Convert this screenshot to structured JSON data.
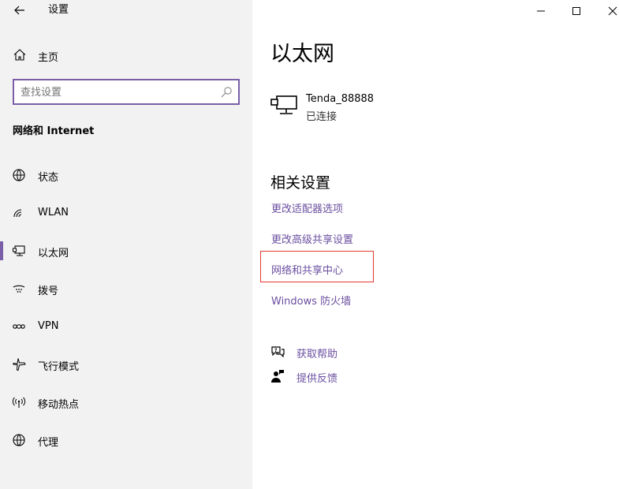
{
  "app": {
    "title": "设置"
  },
  "sidebar": {
    "home_label": "主页",
    "search_placeholder": "查找设置",
    "section_title": "网络和 Internet",
    "items": [
      {
        "label": "状态",
        "icon": "globe-status-icon"
      },
      {
        "label": "WLAN",
        "icon": "wifi-icon"
      },
      {
        "label": "以太网",
        "icon": "ethernet-icon",
        "active": true
      },
      {
        "label": "拨号",
        "icon": "dialup-icon"
      },
      {
        "label": "VPN",
        "icon": "vpn-icon"
      },
      {
        "label": "飞行模式",
        "icon": "airplane-icon"
      },
      {
        "label": "移动热点",
        "icon": "hotspot-icon"
      },
      {
        "label": "代理",
        "icon": "globe-icon"
      }
    ]
  },
  "main": {
    "title": "以太网",
    "connection": {
      "name": "Tenda_88888",
      "status": "已连接"
    },
    "related_title": "相关设置",
    "links": [
      "更改适配器选项",
      "更改高级共享设置",
      "网络和共享中心",
      "Windows 防火墙"
    ],
    "help": [
      {
        "label": "获取帮助",
        "icon": "help-chat-icon"
      },
      {
        "label": "提供反馈",
        "icon": "feedback-icon"
      }
    ]
  },
  "colors": {
    "accent": "#7a5fa8",
    "link": "#6b4fa0",
    "highlight": "#e2392f",
    "sidebar_bg": "#f2f2f2"
  }
}
